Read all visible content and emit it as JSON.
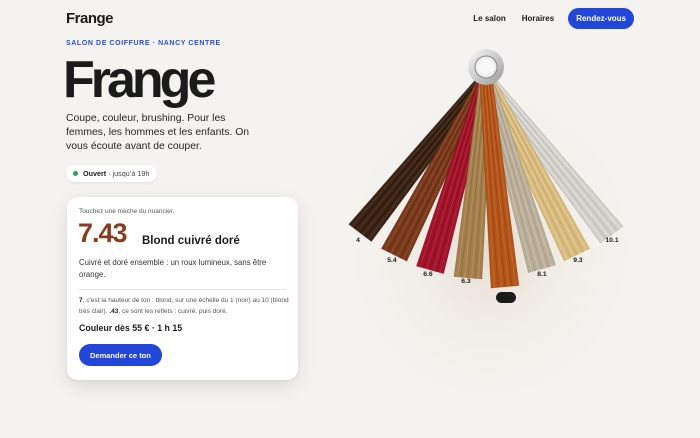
{
  "header": {
    "brand": "Frange",
    "nav": {
      "link1": "Le salon",
      "link2": "Horaires",
      "cta": "Rendez-vous"
    }
  },
  "hero": {
    "eyebrow": "SALON DE COIFFURE · NANCY CENTRE",
    "title": "Frange",
    "lede": "Coupe, couleur, brushing. Pour les femmes, les hommes et les enfants. On vous écoute avant de couper.",
    "status": {
      "label": "Ouvert",
      "hours": "· jusqu’à 19h",
      "color": "#2ea05c"
    }
  },
  "card": {
    "hint": "Touchez une mèche du nuancier.",
    "code": "7.43",
    "name": "Blond cuivré doré",
    "description": "Cuivré et doré ensemble : un roux lumineux, sans être orange.",
    "explain": {
      "level": "7",
      "part1": ", c’est la hauteur de ton : blond, sur une échelle du 1 (noir) au 10 (blond très clair). ",
      "reflect": ".43",
      "part2": ", ce sont les reflets : cuivré, puis doré."
    },
    "price": "Couleur dès 55 € · 1 h 15",
    "button": "Demander ce ton"
  },
  "swatches": {
    "selected": "7.43",
    "items": [
      {
        "tone": "4",
        "color": "#3b2414"
      },
      {
        "tone": "5.4",
        "color": "#7a3a1c"
      },
      {
        "tone": "6.6",
        "color": "#a0152b"
      },
      {
        "tone": "6.3",
        "color": "#a37f4e"
      },
      {
        "tone": "7.43",
        "color": "#b3561c"
      },
      {
        "tone": "8.1",
        "color": "#b9ae99"
      },
      {
        "tone": "9.3",
        "color": "#d8bb7e"
      },
      {
        "tone": "10.1",
        "color": "#d3d0cb"
      }
    ]
  },
  "colors": {
    "accent": "#2146d8",
    "eyebrow": "#2a4fd6",
    "code": "#8a3b1d",
    "background": "#f5f3ef"
  }
}
